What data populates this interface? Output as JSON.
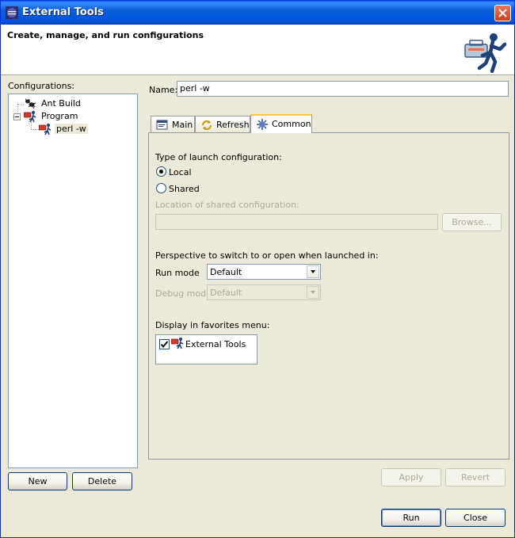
{
  "window": {
    "title": "External Tools",
    "banner_title": "Create, manage, and run configurations",
    "banner_image_icon": "external-tools-runner-icon"
  },
  "left": {
    "configurations_label": "Configurations:",
    "tree": [
      {
        "label": "Ant Build",
        "icon": "ant-icon",
        "level": 0
      },
      {
        "label": "Program",
        "icon": "program-icon",
        "level": 0,
        "expanded": true
      },
      {
        "label": "perl -w",
        "icon": "program-run-icon",
        "level": 1,
        "selected": true
      }
    ],
    "new_label": "New",
    "delete_label": "Delete"
  },
  "right": {
    "name_label": "Name:",
    "name_value": "perl -w",
    "tabs": [
      {
        "label": "Main",
        "icon": "main-tab-icon",
        "active": false
      },
      {
        "label": "Refresh",
        "icon": "refresh-icon",
        "active": false
      },
      {
        "label": "Common",
        "icon": "common-icon",
        "active": true
      }
    ],
    "common": {
      "launch_type_label": "Type of launch configuration:",
      "local_label": "Local",
      "local_selected": true,
      "shared_label": "Shared",
      "shared_location_label": "Location of shared configuration:",
      "shared_location_value": "",
      "browse_label": "Browse...",
      "perspective_label": "Perspective to switch to or open when launched in:",
      "run_mode_label": "Run mode",
      "run_mode_value": "Default",
      "debug_mode_label": "Debug mode",
      "debug_mode_value": "Default",
      "favorites_label": "Display in favorites menu:",
      "favorites": [
        {
          "label": "External Tools",
          "checked": true,
          "icon": "external-tools-icon"
        }
      ]
    },
    "apply_label": "Apply",
    "revert_label": "Revert"
  },
  "footer": {
    "run_label": "Run",
    "close_label": "Close"
  },
  "colors": {
    "title_bar": "#0a5fd9",
    "dialog_bg": "#ece9d8",
    "border": "#7f9db9"
  }
}
